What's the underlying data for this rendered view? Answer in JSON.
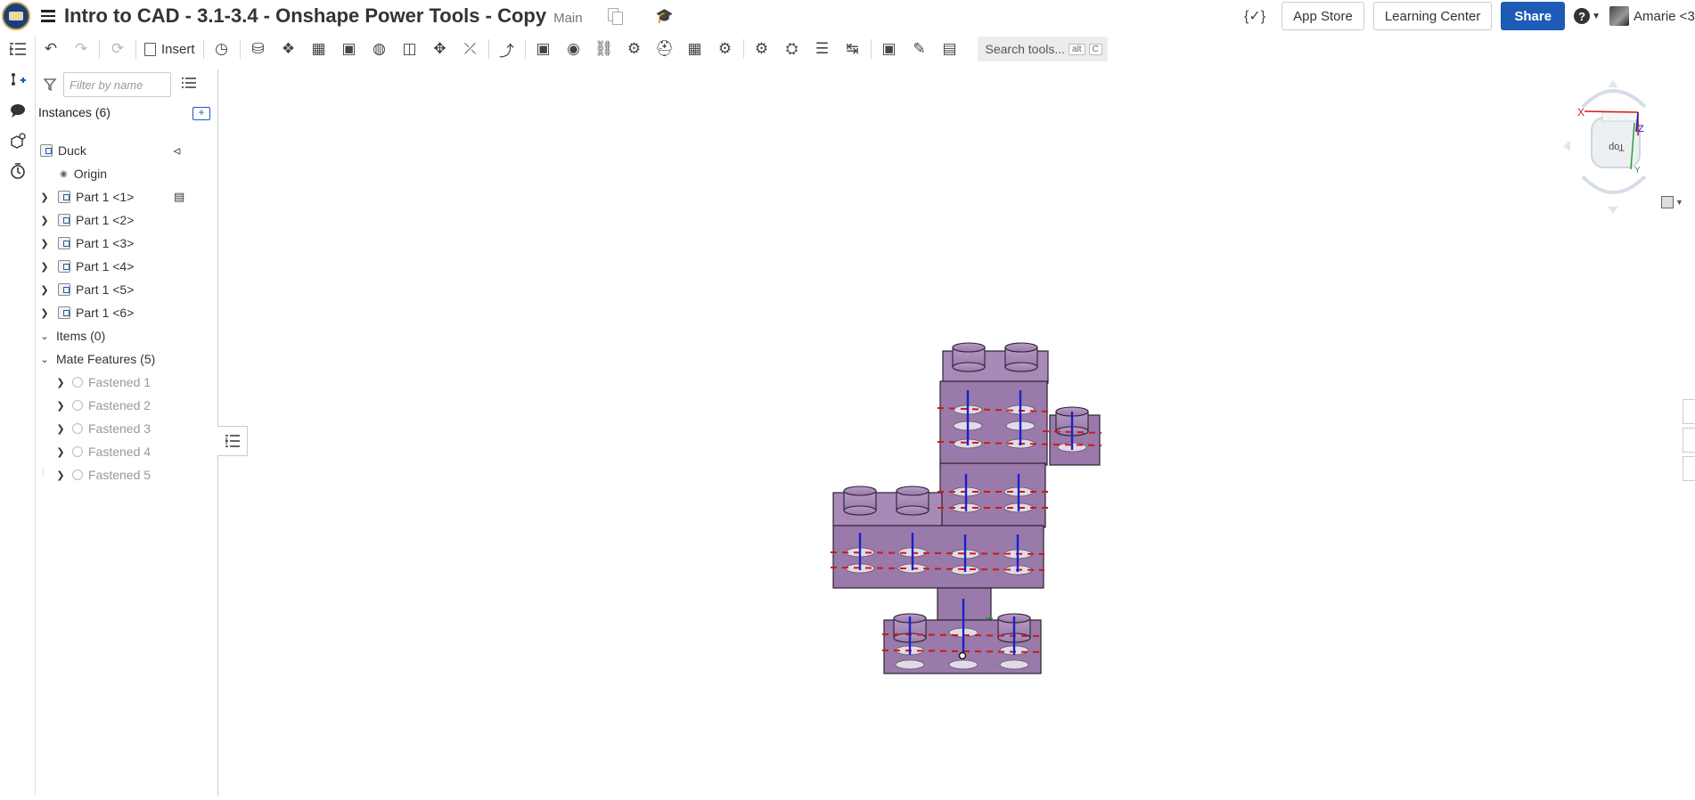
{
  "header": {
    "title": "Intro to CAD - 3.1-3.4 - Onshape Power Tools - Copy",
    "branch": "Main",
    "fx_label": "{✓}",
    "app_store": "App Store",
    "learning_center": "Learning Center",
    "share": "Share",
    "user_name": "Amarie <3"
  },
  "toolbar": {
    "insert_label": "Insert",
    "search_placeholder": "Search tools...",
    "search_kbd1": "alt",
    "search_kbd2": "C"
  },
  "panel": {
    "filter_placeholder": "Filter by name",
    "instances_heading": "Instances (6)",
    "assembly": "Duck",
    "origin": "Origin",
    "parts": [
      "Part 1 <1>",
      "Part 1 <2>",
      "Part 1 <3>",
      "Part 1 <4>",
      "Part 1 <5>",
      "Part 1 <6>"
    ],
    "items_heading": "Items (0)",
    "mate_heading": "Mate Features (5)",
    "mates": [
      "Fastened 1",
      "Fastened 2",
      "Fastened 3",
      "Fastened 4",
      "Fastened 5"
    ]
  },
  "viewcube": {
    "face_label": "Top",
    "axis_x": "X",
    "axis_y": "Y",
    "axis_z": "Z"
  },
  "colors": {
    "accent": "#1d5bb6",
    "part_fill": "#9a7aaa",
    "part_stroke": "#2b2230",
    "mate_axis": "#1a22c8",
    "mate_dash": "#d01818"
  },
  "icons": {
    "logo": "school-seal-logo",
    "rail": [
      "feature-list-icon",
      "add-feature-icon",
      "comments-icon",
      "parts-icon",
      "history-icon"
    ]
  }
}
